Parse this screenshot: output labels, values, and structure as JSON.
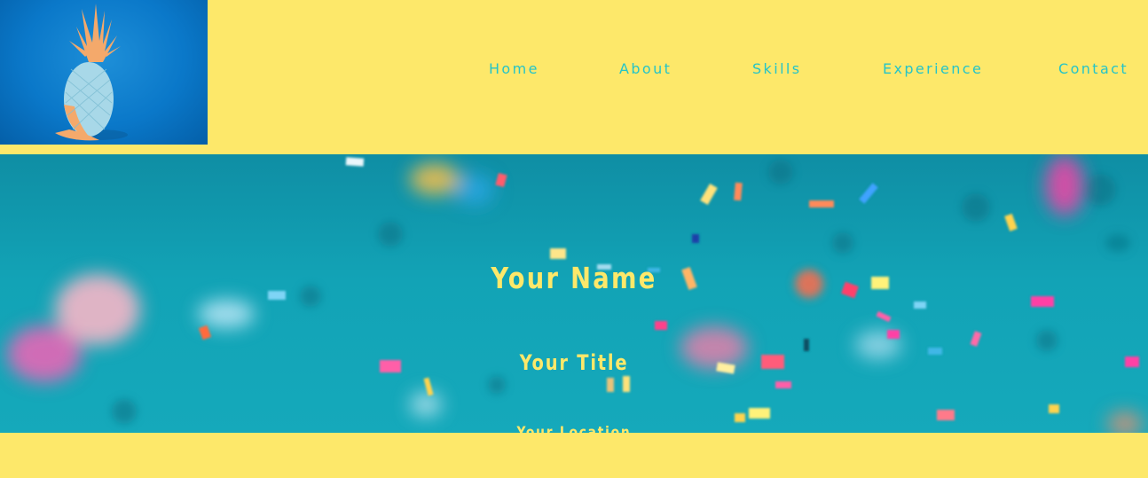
{
  "header": {
    "logo_icon": "pineapple-photo",
    "nav": [
      {
        "label": "Home"
      },
      {
        "label": "About"
      },
      {
        "label": "Skills"
      },
      {
        "label": "Experience"
      },
      {
        "label": "Contact"
      }
    ]
  },
  "hero": {
    "name": "Your Name",
    "title": "Your Title",
    "location": "Your Location",
    "background_icon": "confetti-photo"
  },
  "colors": {
    "page_background": "#FDE86A",
    "nav_text": "#25C4C8",
    "hero_text": "#FDE86A",
    "hero_background": "#12a3b6",
    "logo_background": "#0a78c9"
  }
}
